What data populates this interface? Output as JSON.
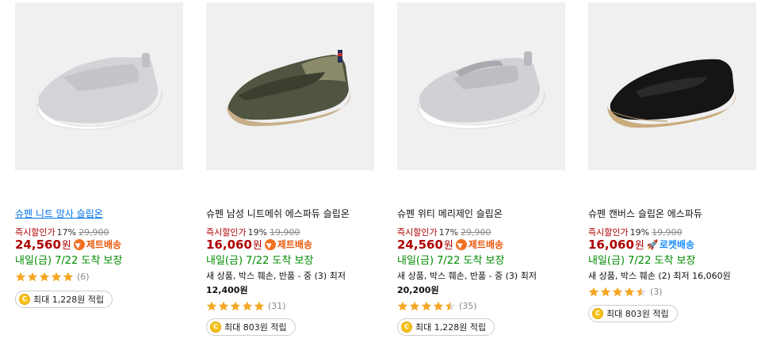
{
  "labels": {
    "discount": "즉시할인가",
    "currency": "원",
    "arrival": "내일(금) 7/22 도착 보장",
    "points_coin": "C"
  },
  "colors": {
    "price": "#ae0000",
    "arrival": "#008c00",
    "jet_badge": "#f27121",
    "rocket_badge": "#1a8cff",
    "star": "#f5a623"
  },
  "products": [
    {
      "title": "슈펜 니트 망사 슬립온",
      "discount_rate": "17%",
      "original_price": "29,900",
      "price": "24,560",
      "badge": {
        "type": "jet",
        "label": "제트배송",
        "icon": "jet-delivery-icon"
      },
      "arrival": "내일(금) 7/22 도착 보장",
      "used_offer": [],
      "rating": 5,
      "review_count": "(6)",
      "points": "최대 1,228원 적립"
    },
    {
      "title": "슈펜 남성 니트메쉬 에스파듀 슬립온",
      "discount_rate": "19%",
      "original_price": "19,900",
      "price": "16,060",
      "badge": {
        "type": "jet",
        "label": "제트배송",
        "icon": "jet-delivery-icon"
      },
      "arrival": "내일(금) 7/22 도착 보장",
      "used_offer": [
        "새 상품, 박스 훼손, 반품 - 중 (3) 최저",
        "12,400원"
      ],
      "rating": 5,
      "review_count": "(31)",
      "points": "최대 803원 적립"
    },
    {
      "title": "슈펜 위티 메리제인 슬립온",
      "discount_rate": "17%",
      "original_price": "29,900",
      "price": "24,560",
      "badge": {
        "type": "jet",
        "label": "제트배송",
        "icon": "jet-delivery-icon"
      },
      "arrival": "내일(금) 7/22 도착 보장",
      "used_offer": [
        "새 상품, 박스 훼손, 반품 - 중 (3) 최저",
        "20,200원"
      ],
      "rating": 4.5,
      "review_count": "(35)",
      "points": "최대 1,228원 적립"
    },
    {
      "title": "슈펜 캔버스 슬립온 에스파듀",
      "discount_rate": "19%",
      "original_price": "19,900",
      "price": "16,060",
      "badge": {
        "type": "rocket",
        "label": "로켓배송",
        "icon": "rocket-delivery-icon"
      },
      "arrival": "내일(금) 7/22 도착 보장",
      "used_offer": [
        "새 상품, 박스 훼손 (2) 최저 16,060원"
      ],
      "rating": 4.5,
      "review_count": "(3)",
      "points": "최대 803원 적립"
    }
  ]
}
